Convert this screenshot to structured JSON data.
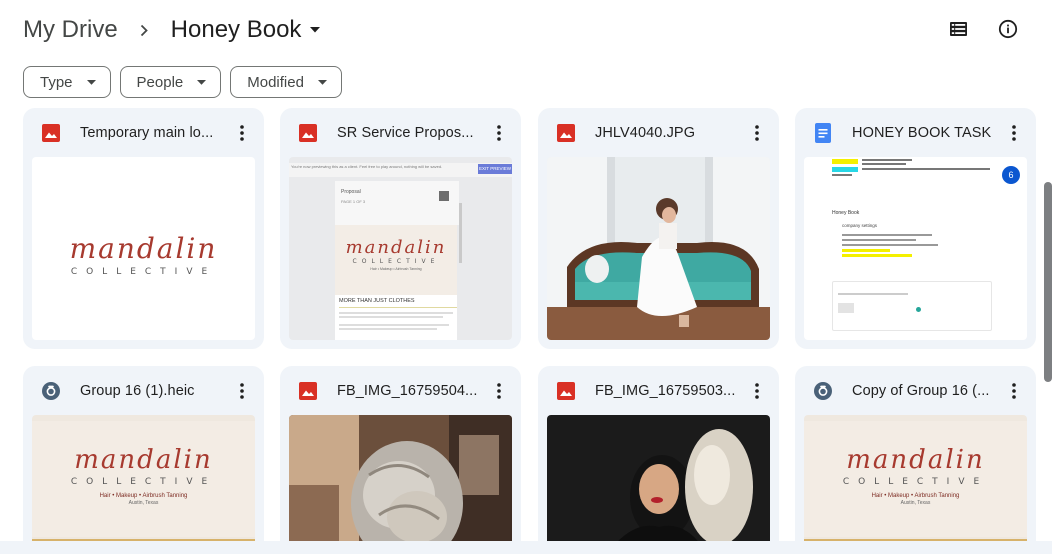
{
  "breadcrumb": {
    "root": "My Drive",
    "current": "Honey Book"
  },
  "header_icons": [
    "list-view-icon",
    "info-icon"
  ],
  "filters": [
    {
      "label": "Type"
    },
    {
      "label": "People"
    },
    {
      "label": "Modified"
    }
  ],
  "files": [
    {
      "name": "Temporary main lo...",
      "type": "image"
    },
    {
      "name": "SR Service Propos...",
      "type": "image"
    },
    {
      "name": "JHLV4040.JPG",
      "type": "image"
    },
    {
      "name": "HONEY BOOK TASK",
      "type": "document"
    },
    {
      "name": "Group 16 (1).heic",
      "type": "photo"
    },
    {
      "name": "FB_IMG_16759504...",
      "type": "image"
    },
    {
      "name": "FB_IMG_16759503...",
      "type": "image"
    },
    {
      "name": "Copy of Group 16 (...",
      "type": "photo"
    }
  ],
  "thumbnails": {
    "logo_script": "mandalin",
    "logo_word": "COLLECTIVE",
    "logo_tagline": "Hair • Makeup • Airbrush Tanning",
    "logo_city": "Austin, Texas",
    "proposal_banner": "You're now previewing this as a client. Feel free to play around, nothing will be saved.",
    "proposal_button": "EXIT PREVIEW",
    "proposal_dropdown": "Proposal",
    "proposal_page": "PAGE 1 OF 3",
    "proposal_heading": "MORE THAN JUST CLOTHES",
    "doc_badge": "6",
    "doc_heading": "Honey Book",
    "doc_bullet": "company settings"
  },
  "colors": {
    "accent_blue": "#0b57d0",
    "image_red": "#d93025",
    "doc_blue": "#4285f4",
    "chip_border": "#747775",
    "card_bg": "#f0f4f9"
  }
}
